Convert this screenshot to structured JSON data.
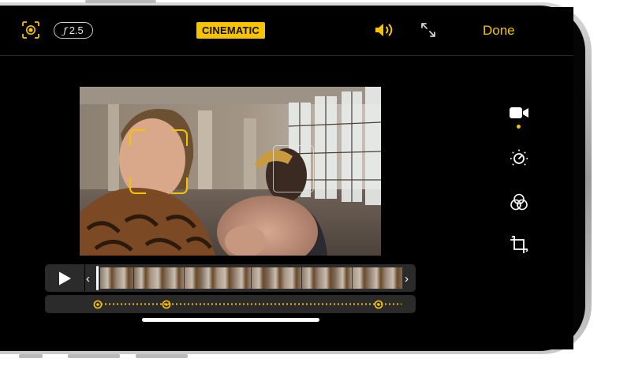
{
  "topbar": {
    "aperture_symbol": "ƒ",
    "aperture_value": "2.5",
    "mode_label": "CINEMATIC",
    "done_label": "Done"
  },
  "icons": {
    "focus_mode": "focus-mode-icon",
    "volume": "volume-icon",
    "fullscreen": "fullscreen-icon",
    "video_tool": "video-camera-icon",
    "adjust_tool": "adjust-dial-icon",
    "filters_tool": "filters-icon",
    "crop_tool": "crop-icon",
    "play": "play-icon",
    "trim_left": "chevron-left-icon",
    "trim_right": "chevron-right-icon"
  },
  "timeline": {
    "trim_left_glyph": "‹",
    "trim_right_glyph": "›"
  },
  "focus_track": {
    "keyframe_count": 3
  },
  "colors": {
    "accent": "#f7c300",
    "background": "#000000",
    "track": "#2b2b2b"
  }
}
